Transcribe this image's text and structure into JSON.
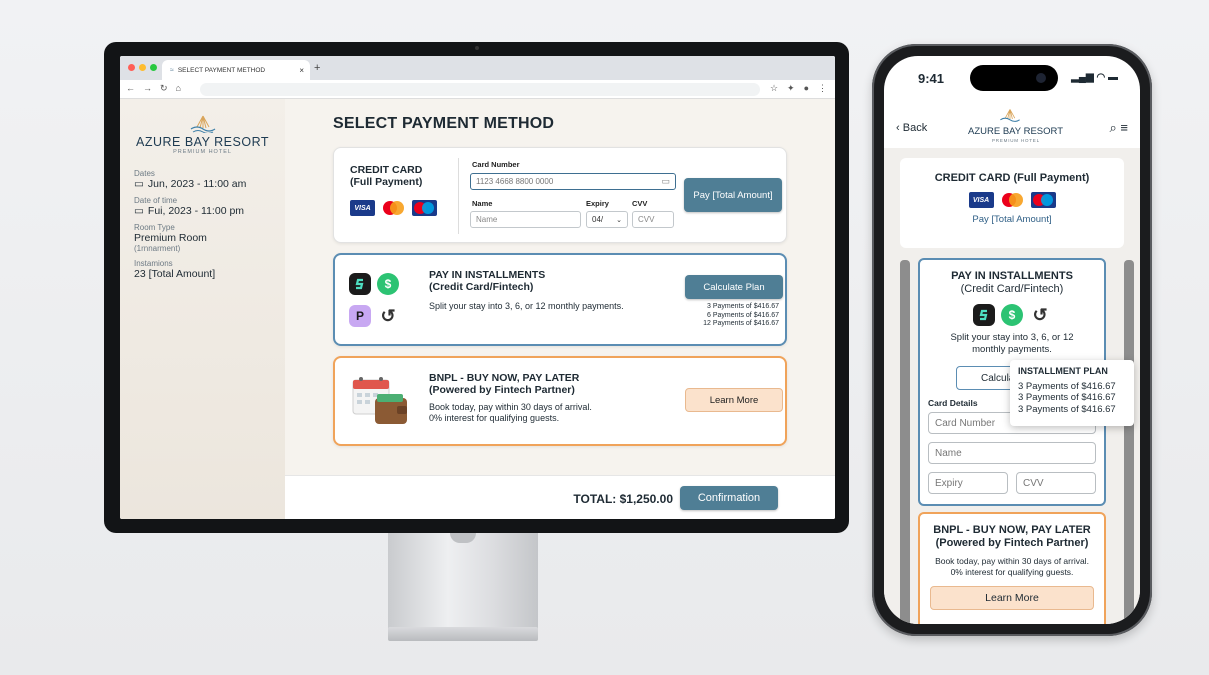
{
  "browser": {
    "tab_title": "SELECT PAYMENT METHOD",
    "tab_close": "×",
    "new_tab": "+"
  },
  "sidebar": {
    "brand": "AZURE BAY RESORT",
    "brand_sub": "PREMIUM HOTEL",
    "dates_label": "Dates",
    "dates_value": "Jun, 2023 - 11:00 am",
    "time_label": "Date of time",
    "time_value": "Fui, 2023 - 11:00 pm",
    "room_label": "Room Type",
    "room_value": "Premium Room",
    "room_sub": "(1rnnarment)",
    "inst_label": "Instamions",
    "inst_value": "23 [Total Amount]"
  },
  "main": {
    "title": "SELECT PAYMENT METHOD",
    "credit_card": {
      "title_line1": "CREDIT CARD",
      "title_line2": "(Full Payment)",
      "card_number_label": "Card Number",
      "card_number_value": "1123 4668 8800 0000",
      "name_label": "Name",
      "name_placeholder": "Name",
      "expiry_label": "Expiry",
      "expiry_value": "04/",
      "cvv_label": "CVV",
      "cvv_placeholder": "CVV",
      "pay_button": "Pay [Total Amount]"
    },
    "installments": {
      "title_line1": "PAY IN INSTALLMENTS",
      "title_line2": "(Credit Card/Fintech)",
      "description": "Split your stay into 3, 6, or 12 monthly payments.",
      "calc_button": "Calculate Plan",
      "payments": [
        "3 Payments of $416.67",
        "6 Payments of $416.67",
        "12 Payments of $416.67"
      ]
    },
    "bnpl": {
      "title_line1": "BNPL - BUY NOW, PAY LATER",
      "title_line2": "(Powered by Fintech Partner)",
      "desc_line1": "Book today, pay within 30 days of arrival.",
      "desc_line2": "0% interest for qualifying guests.",
      "learn_button": "Learn More"
    },
    "total": "TOTAL: $1,250.00",
    "confirm_button": "Confirmation"
  },
  "phone": {
    "time": "9:41",
    "back": "Back",
    "brand": "AZURE BAY RESORT",
    "brand_sub": "PREMIUM HOTEL",
    "cc_title": "CREDIT CARD (Full Payment)",
    "cc_link": "Pay [Total Amount]",
    "inst_title_line1": "PAY IN INSTALLMENTS",
    "inst_title_line2": "(Credit Card/Fintech)",
    "inst_desc_line1": "Split your stay into 3, 6, or 12",
    "inst_desc_line2": "monthly payments.",
    "calc_button": "Calcula",
    "card_details": "Card Details",
    "card_number_placeholder": "Card Number",
    "name_placeholder": "Name",
    "expiry_placeholder": "Expiry",
    "cvv_placeholder": "CVV",
    "tooltip_title": "INSTALLMENT PLAN",
    "tooltip_lines": [
      "3 Payments of $416.67",
      "3 Payments of $416.67",
      "3 Payments of $416.67"
    ],
    "bnpl_title_line1": "BNPL - BUY NOW, PAY LATER",
    "bnpl_title_line2": "(Powered by Fintech Partner)",
    "bnpl_desc_line1": "Book today, pay within 30 days of arrival.",
    "bnpl_desc_line2": "0% interest for qualifying guests.",
    "learn_button": "Learn More"
  },
  "icons": {
    "visa": "VISA",
    "fintech_s": "$",
    "fintech_p": "P"
  },
  "colors": {
    "accent": "#4f7e95",
    "installment_border": "#5b8db3",
    "bnpl_border": "#f0a35a",
    "bnpl_button": "#fbe2cc"
  }
}
